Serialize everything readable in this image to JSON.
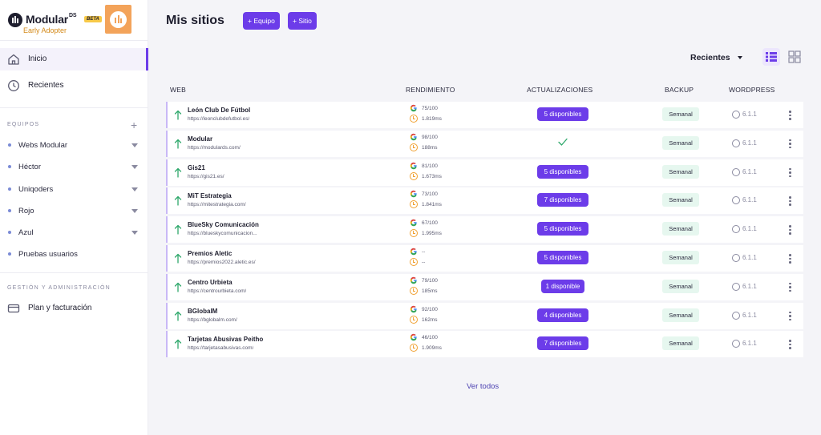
{
  "brand": {
    "name": "Modular",
    "ds": "DS",
    "beta": "BETA",
    "tier": "Early Adopter"
  },
  "nav": [
    {
      "label": "Inicio",
      "icon": "home-icon",
      "active": true
    },
    {
      "label": "Recientes",
      "icon": "clock-icon",
      "active": false
    }
  ],
  "teams": {
    "title": "EQUIPOS",
    "items": [
      {
        "label": "Webs Modular",
        "has_caret": true
      },
      {
        "label": "Héctor",
        "has_caret": true
      },
      {
        "label": "Uniqoders",
        "has_caret": true
      },
      {
        "label": "Rojo",
        "has_caret": true
      },
      {
        "label": "Azul",
        "has_caret": true
      },
      {
        "label": "Pruebas usuarios",
        "has_caret": false
      }
    ]
  },
  "management": {
    "title": "GESTIÓN Y ADMINISTRACIÓN",
    "items": [
      {
        "label": "Plan y facturación",
        "icon": "billing-card-icon"
      }
    ]
  },
  "header": {
    "title": "Mis sitios",
    "add_team": "+ Equipo",
    "add_site": "+ Sitio",
    "sort": "Recientes"
  },
  "table": {
    "columns": {
      "web": "WEB",
      "performance": "RENDIMIENTO",
      "updates": "ACTUALIZACIONES",
      "backup": "BACKUP",
      "wordpress": "WORDPRESS"
    },
    "rows": [
      {
        "name": "León Club De Fútbol",
        "url": "https://leonclubdefutbol.es/",
        "score": "75/100",
        "time": "1.819ms",
        "updates": "5 disponibles",
        "backup": "Semanal",
        "wp": "6.1.1"
      },
      {
        "name": "Modular",
        "url": "https://modulards.com/",
        "score": "98/100",
        "time": "188ms",
        "updates": "",
        "backup": "Semanal",
        "wp": "6.1.1"
      },
      {
        "name": "Gis21",
        "url": "https://gis21.es/",
        "score": "81/100",
        "time": "1.673ms",
        "updates": "5 disponibles",
        "backup": "Semanal",
        "wp": "6.1.1"
      },
      {
        "name": "MiT Estrategia",
        "url": "https://mitestrategia.com/",
        "score": "73/100",
        "time": "1.841ms",
        "updates": "7 disponibles",
        "backup": "Semanal",
        "wp": "6.1.1"
      },
      {
        "name": "BlueSky Comunicación",
        "url": "https://blueskycomunicacion...",
        "score": "67/100",
        "time": "1.995ms",
        "updates": "5 disponibles",
        "backup": "Semanal",
        "wp": "6.1.1"
      },
      {
        "name": "Premios Aletic",
        "url": "https://premios2022.aletic.es/",
        "score": "--",
        "time": "--",
        "updates": "5 disponibles",
        "backup": "Semanal",
        "wp": "6.1.1"
      },
      {
        "name": "Centro Urbieta",
        "url": "https://centrourbieta.com/",
        "score": "79/100",
        "time": "185ms",
        "updates": "1 disponible",
        "backup": "Semanal",
        "wp": "6.1.1"
      },
      {
        "name": "BGlobalM",
        "url": "https://bglobalm.com/",
        "score": "92/100",
        "time": "162ms",
        "updates": "4 disponibles",
        "backup": "Semanal",
        "wp": "6.1.1"
      },
      {
        "name": "Tarjetas Abusivas Peitho",
        "url": "https://tarjetasabusivas.com/",
        "score": "46/100",
        "time": "1.909ms",
        "updates": "7 disponibles",
        "backup": "Semanal",
        "wp": "6.1.1"
      }
    ]
  },
  "footer": {
    "see_all": "Ver todos"
  },
  "colors": {
    "accent": "#6c3ce9",
    "brand_orange": "#f3a35a",
    "backup_bg": "#e6f7ef",
    "up_arrow": "#2ea86b",
    "google_blue": "#4285f4"
  }
}
